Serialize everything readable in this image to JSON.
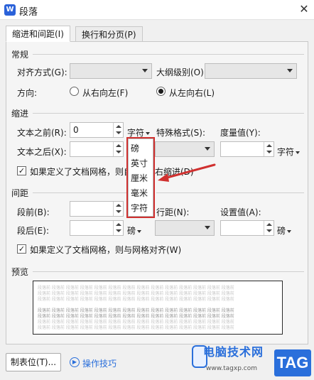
{
  "window": {
    "icon_text": "W",
    "title": "段落",
    "close_glyph": "✕"
  },
  "tabs": [
    {
      "label": "缩进和间距(I)"
    },
    {
      "label": "换行和分页(P)"
    }
  ],
  "general": {
    "heading": "常规",
    "align_label": "对齐方式(G):",
    "outline_label": "大纲级别(O):",
    "direction_label": "方向:",
    "rtl_label": "从右向左(F)",
    "ltr_label": "从左向右(L)",
    "direction_selected": "从左向右(L)"
  },
  "indent": {
    "heading": "缩进",
    "before_label": "文本之前(R):",
    "before_value": "0",
    "before_unit": "字符",
    "special_label": "特殊格式(S):",
    "measure_label": "度量值(Y):",
    "after_label": "文本之后(X):",
    "measure_unit": "字符",
    "grid_check_label_pre": "如果定义了文档网格，则自",
    "grid_check_label_post": "右缩进(D)",
    "grid_checked": true
  },
  "unit_dropdown": {
    "options": [
      "磅",
      "英寸",
      "厘米",
      "毫米",
      "字符"
    ],
    "highlight_color": "#d0302f"
  },
  "spacing": {
    "heading": "间距",
    "before_label": "段前(B):",
    "after_label": "段后(E):",
    "after_unit": "磅",
    "line_label": "行距(N):",
    "setting_label": "设置值(A):",
    "setting_unit": "磅",
    "grid_check_label": "如果定义了文档网格，则与网格对齐(W)",
    "grid_checked": true
  },
  "preview": {
    "heading": "预览",
    "sample_word": "段落前"
  },
  "footer": {
    "tabs_button": "制表位(T)...",
    "tips_label": "操作技巧"
  },
  "watermark": {
    "site_name": "电脑技术网",
    "url": "www.tagxp.com",
    "tag": "TAG"
  },
  "colors": {
    "accent": "#2a6fdb",
    "annotation": "#d0302f"
  }
}
